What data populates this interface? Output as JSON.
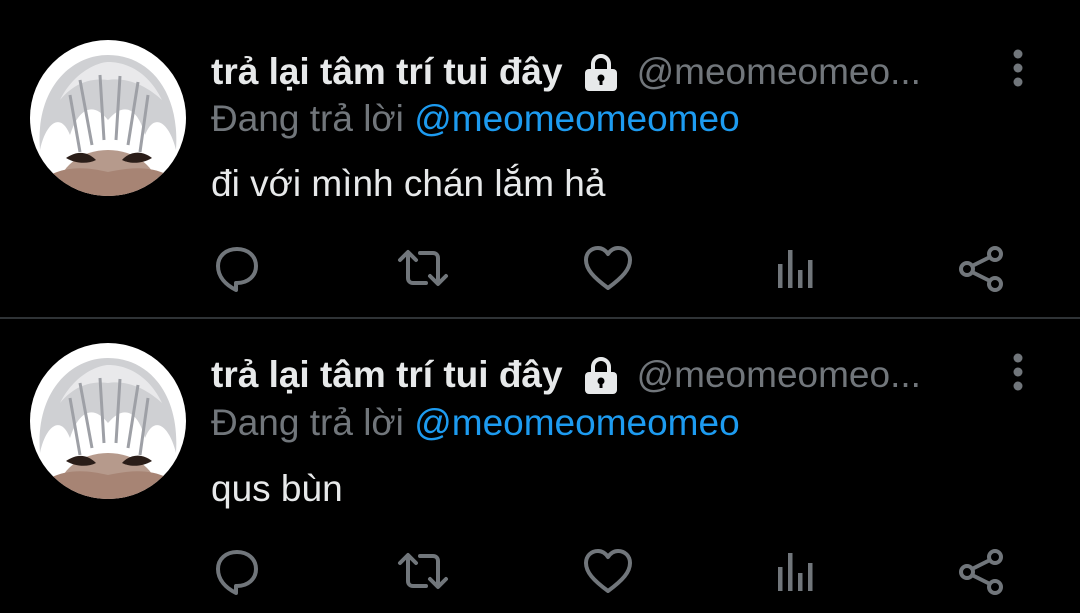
{
  "colors": {
    "background": "#000000",
    "text": "#e7e9ea",
    "muted": "#71767b",
    "link": "#1d9bf0",
    "divider": "#2f3336"
  },
  "tweets": [
    {
      "display_name": "trả lại tâm trí tui đây",
      "handle": "@meomeomeo...",
      "reply_prefix": "Đang trả lời ",
      "reply_to": "@meomeomeomeo",
      "text": "đi với mình chán lắm hả",
      "icons": {
        "lock": "lock-icon",
        "more": "more-vertical-icon",
        "reply": "reply-icon",
        "retweet": "retweet-icon",
        "like": "heart-icon",
        "views": "views-chart-icon",
        "share": "share-icon"
      }
    },
    {
      "display_name": "trả lại tâm trí tui đây",
      "handle": "@meomeomeo...",
      "reply_prefix": "Đang trả lời ",
      "reply_to": "@meomeomeomeo",
      "text": "qus bùn",
      "icons": {
        "lock": "lock-icon",
        "more": "more-vertical-icon",
        "reply": "reply-icon",
        "retweet": "retweet-icon",
        "like": "heart-icon",
        "views": "views-chart-icon",
        "share": "share-icon"
      }
    }
  ]
}
